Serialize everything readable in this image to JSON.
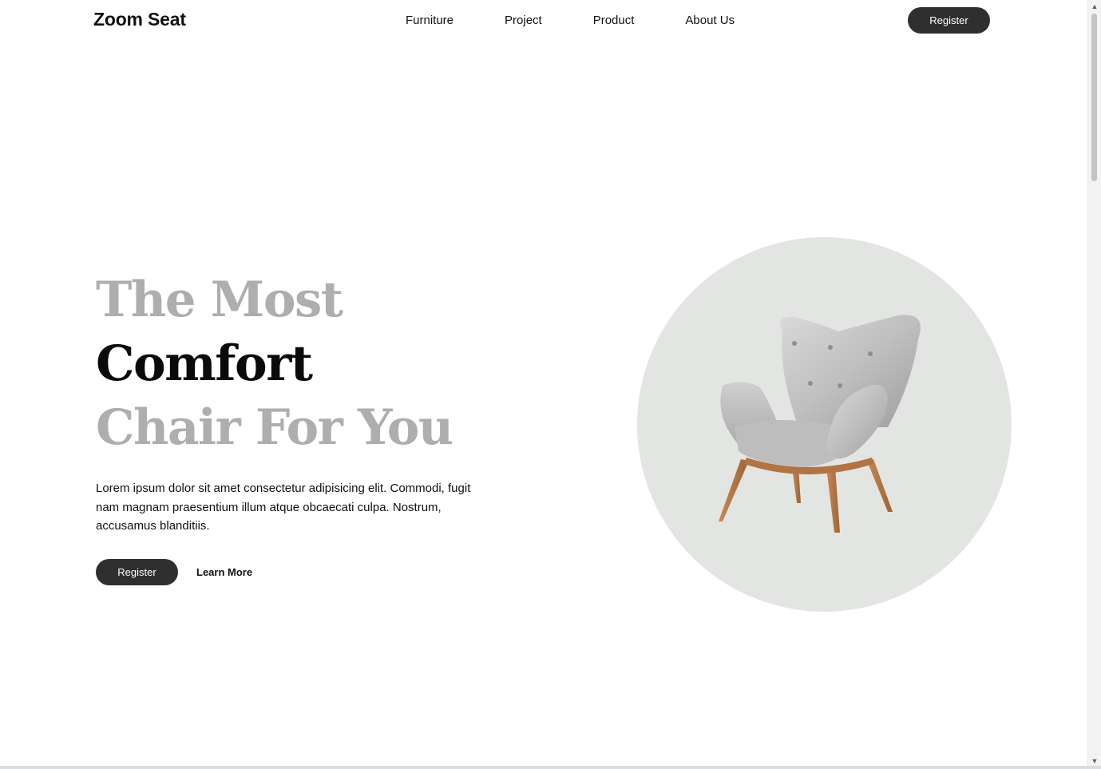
{
  "brand": {
    "name": "Zoom Seat"
  },
  "nav": {
    "links": [
      "Furniture",
      "Project",
      "Product",
      "About Us"
    ],
    "register_label": "Register"
  },
  "hero": {
    "headline": {
      "line1": "The Most",
      "line2": "Comfort",
      "line3": "Chair For You"
    },
    "description": "Lorem ipsum dolor sit amet consectetur adipisicing elit. Commodi, fugit nam magnam praesentium illum atque obcaecati culpa. Nostrum, accusamus blanditiis.",
    "register_label": "Register",
    "learn_more_label": "Learn More"
  },
  "colors": {
    "button_bg": "#2f2f2f",
    "headline_muted": "#aeaeae",
    "headline_strong": "#0a0a0a",
    "circle_bg": "#e3e5e3"
  },
  "icons": {
    "scroll_up": "chevron-up-icon",
    "scroll_down": "chevron-down-icon",
    "hero_image": "armchair-image"
  }
}
